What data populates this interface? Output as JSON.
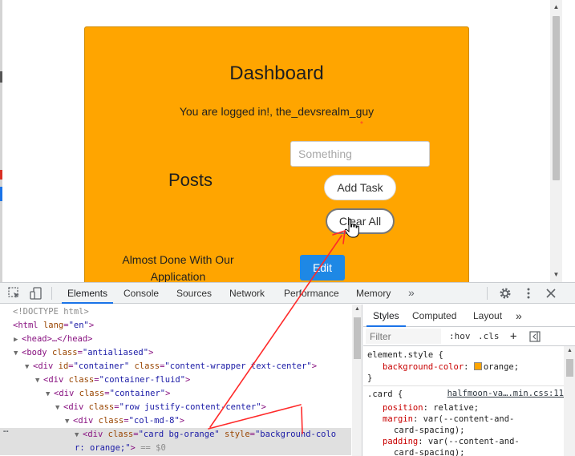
{
  "page": {
    "card": {
      "background_color": "#ffa500",
      "title": "Dashboard",
      "greeting": "You are logged in!, the_devsrealm_guy",
      "required_marker": "*",
      "task_input": {
        "placeholder": "Something",
        "value": ""
      },
      "posts_heading": "Posts",
      "add_task_label": "Add Task",
      "clear_all_label": "Clear All",
      "task_item_text": "Almost Done With Our Application",
      "edit_label": "Edit"
    }
  },
  "devtools": {
    "toolbar_icons": [
      "inspect-icon",
      "device-toggle-icon"
    ],
    "tabs": [
      {
        "label": "Elements",
        "active": true
      },
      {
        "label": "Console",
        "active": false
      },
      {
        "label": "Sources",
        "active": false
      },
      {
        "label": "Network",
        "active": false
      },
      {
        "label": "Performance",
        "active": false
      },
      {
        "label": "Memory",
        "active": false
      }
    ],
    "more_tabs": "»",
    "dom_tree": {
      "line1": "<!DOCTYPE html>",
      "line2_tag": "html",
      "line2_attr": "lang",
      "line2_val": "\"en\"",
      "line3": "<head>…</head>",
      "line4_tag": "body",
      "line4_attr": "class",
      "line4_val": "\"antialiased\"",
      "line5_tag": "div",
      "line5_attr1": "id",
      "line5_val1": "\"container\"",
      "line5_attr2": "class",
      "line5_val2": "\"content-wrapper text-center\"",
      "line6_tag": "div",
      "line6_attr": "class",
      "line6_val": "\"container-fluid\"",
      "line7_tag": "div",
      "line7_attr": "class",
      "line7_val": "\"container\"",
      "line8_tag": "div",
      "line8_attr": "class",
      "line8_val": "\"row justify-content-center\"",
      "line9_tag": "div",
      "line9_attr": "class",
      "line9_val": "\"col-md-8\"",
      "line10_tag": "div",
      "line10_attr1": "class",
      "line10_val1": "\"card bg-orange\"",
      "line10_attr2": "style",
      "line10_val2a": "\"background-colo",
      "line11_val2b": "r: orange;\"",
      "line11_marker": "== $0",
      "selected_row_dots": "…"
    },
    "styles": {
      "tabs": [
        {
          "label": "Styles",
          "active": true
        },
        {
          "label": "Computed",
          "active": false
        },
        {
          "label": "Layout",
          "active": false
        }
      ],
      "more_tabs": "»",
      "filter_placeholder": "Filter",
      "hov_label": ":hov",
      "cls_label": ".cls",
      "add_rule": "+",
      "element_style_selector": "element.style {",
      "element_style_prop": "background-color",
      "element_style_value": "orange;",
      "element_style_close": "}",
      "card_selector": ".card {",
      "card_source": "halfmoon-va….min.css:11",
      "card_props": [
        {
          "prop": "position",
          "value": "relative;"
        },
        {
          "prop": "margin",
          "value": "var(--content-and-"
        },
        {
          "prop": "",
          "value": "card-spacing);"
        },
        {
          "prop": "padding",
          "value": "var(--content-and-"
        },
        {
          "prop": "",
          "value": "card-spacing);"
        }
      ]
    }
  },
  "annotation_color": "#ff2a2a"
}
